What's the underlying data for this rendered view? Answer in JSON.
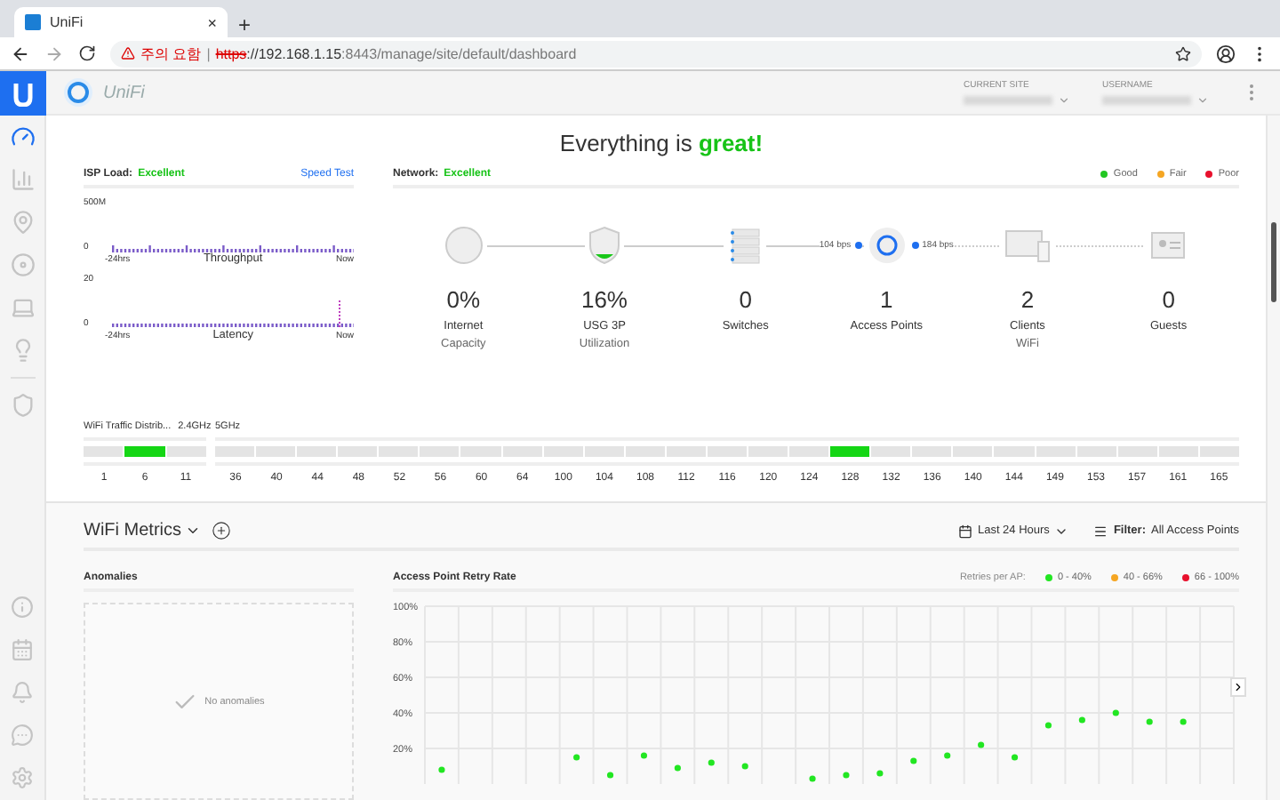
{
  "browser": {
    "tab": {
      "title": "UniFi",
      "close": "×"
    },
    "new_tab": "+",
    "address": {
      "warning": "주의 요함",
      "separator": "|",
      "scheme": "https",
      "host": "://192.168.1.15",
      "rest": ":8443/manage/site/default/dashboard"
    }
  },
  "sidebar": {
    "items": [
      {
        "kind": "dashboard",
        "selected": true
      },
      {
        "kind": "stats",
        "selected": false
      },
      {
        "kind": "map",
        "selected": false
      },
      {
        "kind": "devices",
        "selected": false
      },
      {
        "kind": "clients",
        "selected": false
      },
      {
        "kind": "insights",
        "selected": false
      },
      {
        "kind": "shield",
        "selected": false
      }
    ],
    "bottom": [
      {
        "kind": "info"
      },
      {
        "kind": "calendar"
      },
      {
        "kind": "bell"
      },
      {
        "kind": "chat"
      },
      {
        "kind": "settings"
      }
    ]
  },
  "header": {
    "logo": "UniFi",
    "site_label": "CURRENT SITE",
    "user_label": "USERNAME"
  },
  "status": "Everything is **great!**",
  "isp": {
    "label": "ISP Load:",
    "value": "Excellent",
    "speed_test": "Speed Test",
    "charts": [
      {
        "max": "500M",
        "min": "0",
        "start": "-24hrs",
        "title": "Throughput",
        "end": "Now",
        "spike": false
      },
      {
        "max": "20",
        "min": "0",
        "start": "-24hrs",
        "title": "Latency",
        "end": "Now",
        "spike": true
      }
    ]
  },
  "network": {
    "label": "Network:",
    "value": "Excellent",
    "legend": [
      {
        "label": "Good",
        "color": "#22c722"
      },
      {
        "label": "Fair",
        "color": "#f5a623"
      },
      {
        "label": "Poor",
        "color": "#e8112d"
      }
    ],
    "nodes": [
      {
        "kind": "internet",
        "value": "0%",
        "label": "Internet",
        "sublabel": "Capacity"
      },
      {
        "kind": "gateway",
        "value": "16%",
        "label": "USG 3P",
        "sublabel": "Utilization"
      },
      {
        "kind": "switch",
        "value": "0",
        "label": "Switches"
      },
      {
        "kind": "ap",
        "value": "1",
        "label": "Access Points",
        "link_in": "104 bps",
        "link_out": "184 bps"
      },
      {
        "kind": "clients",
        "value": "2",
        "label": "Clients",
        "sublabel": "WiFi"
      },
      {
        "kind": "guests",
        "value": "0",
        "label": "Guests"
      }
    ]
  },
  "wifi_traffic": {
    "title": "WiFi Traffic Distrib...",
    "bands": [
      {
        "label": "2.4GHz",
        "channels": [
          {
            "label": "1",
            "active": false
          },
          {
            "label": "6",
            "active": true
          },
          {
            "label": "11",
            "active": false
          }
        ]
      },
      {
        "label": "5GHz",
        "channels": [
          {
            "label": "36",
            "active": false
          },
          {
            "label": "40",
            "active": false
          },
          {
            "label": "44",
            "active": false
          },
          {
            "label": "48",
            "active": false
          },
          {
            "label": "52",
            "active": false
          },
          {
            "label": "56",
            "active": false
          },
          {
            "label": "60",
            "active": false
          },
          {
            "label": "64",
            "active": false
          },
          {
            "label": "100",
            "active": false
          },
          {
            "label": "104",
            "active": false
          },
          {
            "label": "108",
            "active": false
          },
          {
            "label": "112",
            "active": false
          },
          {
            "label": "116",
            "active": false
          },
          {
            "label": "120",
            "active": false
          },
          {
            "label": "124",
            "active": false
          },
          {
            "label": "128",
            "active": true
          },
          {
            "label": "132",
            "active": false
          },
          {
            "label": "136",
            "active": false
          },
          {
            "label": "140",
            "active": false
          },
          {
            "label": "144",
            "active": false
          },
          {
            "label": "149",
            "active": false
          },
          {
            "label": "153",
            "active": false
          },
          {
            "label": "157",
            "active": false
          },
          {
            "label": "161",
            "active": false
          },
          {
            "label": "165",
            "active": false
          }
        ]
      }
    ]
  },
  "metrics": {
    "title": "WiFi Metrics",
    "range": "Last 24 Hours",
    "filter_label": "Filter:",
    "filter_value": "All Access Points",
    "anomalies": {
      "title": "Anomalies",
      "empty": "No anomalies"
    },
    "retry": {
      "title": "Access Point Retry Rate",
      "legend_label": "Retries per AP:",
      "legend": [
        {
          "label": "40 - 66%",
          "color": "#f5a623"
        },
        {
          "label": "66 - 100%",
          "color": "#e8112d"
        }
      ],
      "chart_data": {
        "type": "scatter",
        "grid": true,
        "ylim": [
          0,
          100
        ],
        "yticks": [
          {
            "value": 20,
            "label": "20%"
          },
          {
            "value": 40,
            "label": "40%"
          },
          {
            "value": 60,
            "label": "60%"
          },
          {
            "value": 80,
            "label": "80%"
          },
          {
            "value": 100,
            "label": "100%"
          }
        ],
        "series": [
          {
            "name": "0 - 40%",
            "color": "#22e622",
            "values": [
              8,
              null,
              null,
              null,
              15,
              5,
              16,
              9,
              12,
              10,
              null,
              3,
              5,
              6,
              13,
              16,
              22,
              15,
              33,
              36,
              40,
              35,
              35,
              null
            ]
          }
        ]
      }
    }
  }
}
